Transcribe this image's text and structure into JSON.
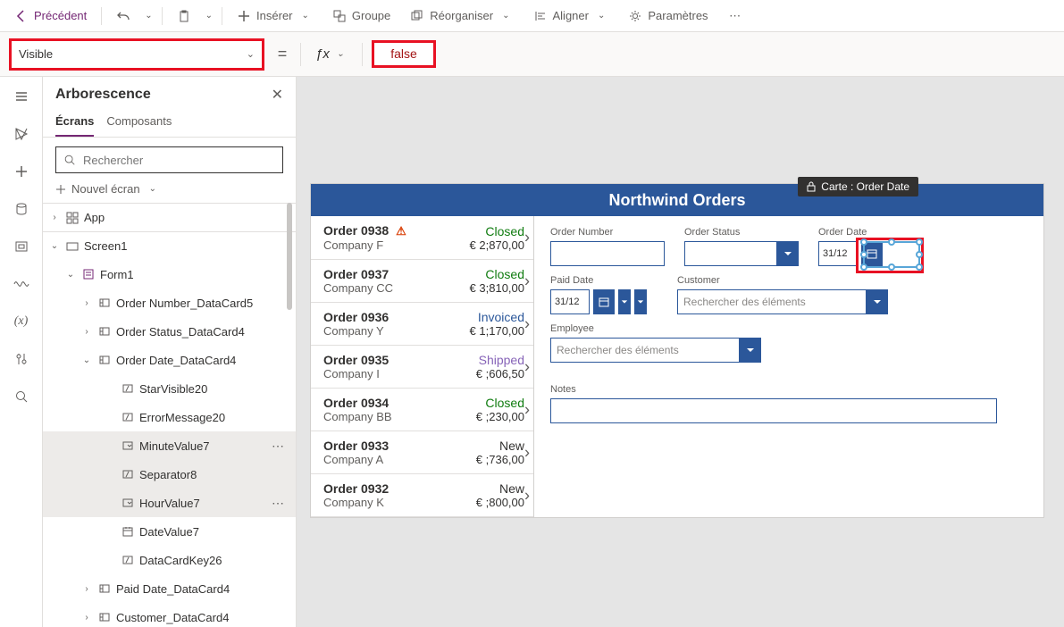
{
  "toolbar": {
    "back": "Précédent",
    "insert": "Insérer",
    "group": "Groupe",
    "reorder": "Réorganiser",
    "align": "Aligner",
    "settings": "Paramètres"
  },
  "formula": {
    "property": "Visible",
    "value": "false"
  },
  "tree": {
    "title": "Arborescence",
    "tab_screens": "Écrans",
    "tab_components": "Composants",
    "search_placeholder": "Rechercher",
    "new_screen": "Nouvel écran",
    "nodes": {
      "app": "App",
      "screen1": "Screen1",
      "form1": "Form1",
      "ordernum": "Order Number_DataCard5",
      "orderstatus": "Order Status_DataCard4",
      "orderdate": "Order Date_DataCard4",
      "starvisible": "StarVisible20",
      "errmsg": "ErrorMessage20",
      "minute": "MinuteValue7",
      "sep": "Separator8",
      "hour": "HourValue7",
      "datevalue": "DateValue7",
      "datacardkey": "DataCardKey26",
      "paiddate": "Paid Date_DataCard4",
      "customer": "Customer_DataCard4"
    }
  },
  "canvas": {
    "header": "Northwind Orders",
    "tooltip_lock": "Carte : Order Date",
    "labels": {
      "order_number": "Order Number",
      "order_status": "Order Status",
      "order_date": "Order Date",
      "paid_date": "Paid Date",
      "customer": "Customer",
      "employee": "Employee",
      "notes": "Notes"
    },
    "placeholders": {
      "search_items": "Rechercher des éléments"
    },
    "date_sample": "31/12",
    "gallery": [
      {
        "id": "Order 0938",
        "warn": true,
        "status": "Closed",
        "status_cls": "status-closed",
        "company": "Company F",
        "price": "€ 2;870,00"
      },
      {
        "id": "Order 0937",
        "warn": false,
        "status": "Closed",
        "status_cls": "status-closed",
        "company": "Company CC",
        "price": "€ 3;810,00"
      },
      {
        "id": "Order 0936",
        "warn": false,
        "status": "Invoiced",
        "status_cls": "status-invoiced",
        "company": "Company Y",
        "price": "€ 1;170,00"
      },
      {
        "id": "Order 0935",
        "warn": false,
        "status": "Shipped",
        "status_cls": "status-shipped",
        "company": "Company I",
        "price": "€ ;606,50"
      },
      {
        "id": "Order 0934",
        "warn": false,
        "status": "Closed",
        "status_cls": "status-closed",
        "company": "Company BB",
        "price": "€ ;230,00"
      },
      {
        "id": "Order 0933",
        "warn": false,
        "status": "New",
        "status_cls": "status-new",
        "company": "Company A",
        "price": "€ ;736,00"
      },
      {
        "id": "Order 0932",
        "warn": false,
        "status": "New",
        "status_cls": "status-new",
        "company": "Company K",
        "price": "€ ;800,00"
      }
    ]
  }
}
